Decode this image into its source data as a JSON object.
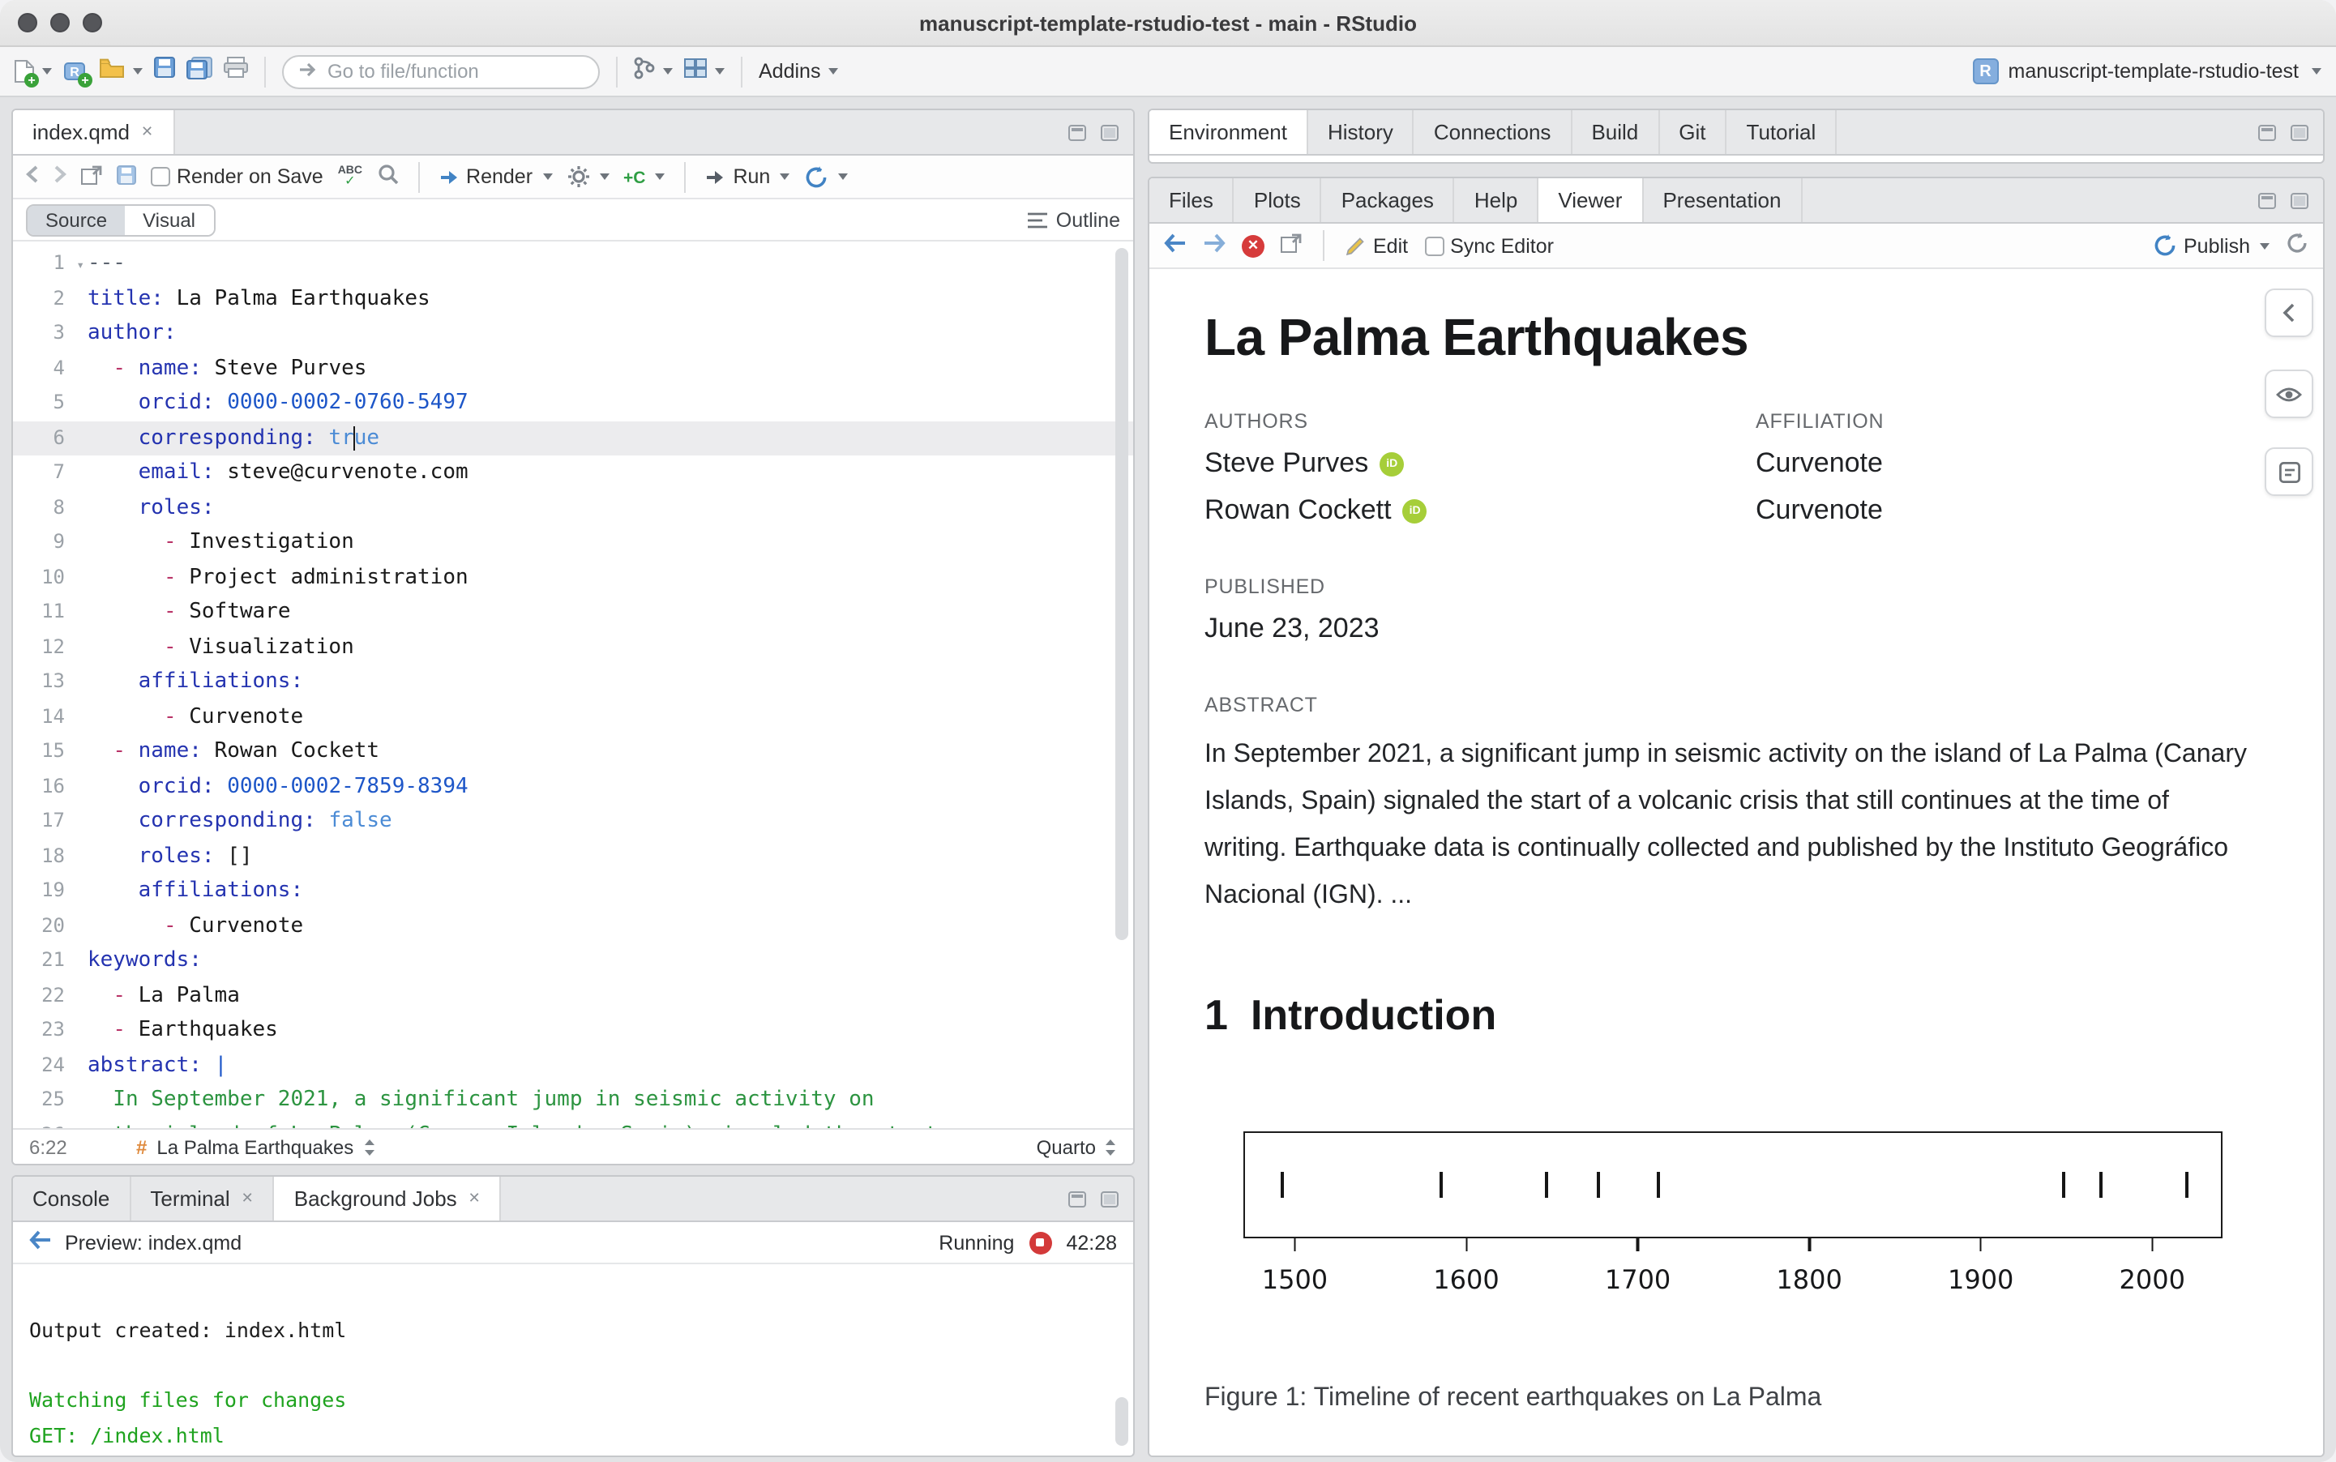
{
  "window": {
    "title": "manuscript-template-rstudio-test - main - RStudio"
  },
  "icons": {
    "close": "✕",
    "fold": "▾",
    "hash": "#"
  },
  "main_toolbar": {
    "goto_placeholder": "Go to file/function",
    "addins_label": "Addins",
    "project_label": "manuscript-template-rstudio-test"
  },
  "source_pane": {
    "tabs": [
      {
        "label": "index.qmd",
        "close": true,
        "active": true
      }
    ],
    "toolbar": {
      "render_on_save_label": "Render on Save",
      "render_label": "Render",
      "run_label": "Run"
    },
    "mode_toggle": {
      "source_label": "Source",
      "visual_label": "Visual"
    },
    "outline_label": "Outline",
    "status": {
      "cursor_position": "6:22",
      "section_label": "La Palma Earthquakes",
      "doc_type": "Quarto"
    },
    "code_lines": [
      {
        "n": 1,
        "fold": true,
        "tokens": [
          [
            "meta",
            "---"
          ]
        ]
      },
      {
        "n": 2,
        "tokens": [
          [
            "key",
            "title:"
          ],
          [
            "plain",
            " La Palma Earthquakes"
          ]
        ]
      },
      {
        "n": 3,
        "tokens": [
          [
            "key",
            "author:"
          ]
        ]
      },
      {
        "n": 4,
        "tokens": [
          [
            "plain",
            "  "
          ],
          [
            "dash",
            "- "
          ],
          [
            "key",
            "name:"
          ],
          [
            "plain",
            " Steve Purves"
          ]
        ]
      },
      {
        "n": 5,
        "tokens": [
          [
            "plain",
            "    "
          ],
          [
            "key",
            "orcid:"
          ],
          [
            "plain",
            " "
          ],
          [
            "num",
            "0000-0002-0760-5497"
          ]
        ]
      },
      {
        "n": 6,
        "highlight": true,
        "tokens": [
          [
            "plain",
            "    "
          ],
          [
            "key",
            "corresponding:"
          ],
          [
            "plain",
            " "
          ],
          [
            "bool",
            "tr"
          ],
          [
            "cursor",
            ""
          ],
          [
            "bool",
            "ue"
          ]
        ]
      },
      {
        "n": 7,
        "tokens": [
          [
            "plain",
            "    "
          ],
          [
            "key",
            "email:"
          ],
          [
            "plain",
            " steve@curvenote.com"
          ]
        ]
      },
      {
        "n": 8,
        "tokens": [
          [
            "plain",
            "    "
          ],
          [
            "key",
            "roles:"
          ]
        ]
      },
      {
        "n": 9,
        "tokens": [
          [
            "plain",
            "      "
          ],
          [
            "dash",
            "- "
          ],
          [
            "plain",
            "Investigation"
          ]
        ]
      },
      {
        "n": 10,
        "tokens": [
          [
            "plain",
            "      "
          ],
          [
            "dash",
            "- "
          ],
          [
            "plain",
            "Project administration"
          ]
        ]
      },
      {
        "n": 11,
        "tokens": [
          [
            "plain",
            "      "
          ],
          [
            "dash",
            "- "
          ],
          [
            "plain",
            "Software"
          ]
        ]
      },
      {
        "n": 12,
        "tokens": [
          [
            "plain",
            "      "
          ],
          [
            "dash",
            "- "
          ],
          [
            "plain",
            "Visualization"
          ]
        ]
      },
      {
        "n": 13,
        "tokens": [
          [
            "plain",
            "    "
          ],
          [
            "key",
            "affiliations:"
          ]
        ]
      },
      {
        "n": 14,
        "tokens": [
          [
            "plain",
            "      "
          ],
          [
            "dash",
            "- "
          ],
          [
            "plain",
            "Curvenote"
          ]
        ]
      },
      {
        "n": 15,
        "tokens": [
          [
            "plain",
            "  "
          ],
          [
            "dash",
            "- "
          ],
          [
            "key",
            "name:"
          ],
          [
            "plain",
            " Rowan Cockett"
          ]
        ]
      },
      {
        "n": 16,
        "tokens": [
          [
            "plain",
            "    "
          ],
          [
            "key",
            "orcid:"
          ],
          [
            "plain",
            " "
          ],
          [
            "num",
            "0000-0002-7859-8394"
          ]
        ]
      },
      {
        "n": 17,
        "tokens": [
          [
            "plain",
            "    "
          ],
          [
            "key",
            "corresponding:"
          ],
          [
            "plain",
            " "
          ],
          [
            "bool",
            "false"
          ]
        ]
      },
      {
        "n": 18,
        "tokens": [
          [
            "plain",
            "    "
          ],
          [
            "key",
            "roles:"
          ],
          [
            "plain",
            " []"
          ]
        ]
      },
      {
        "n": 19,
        "tokens": [
          [
            "plain",
            "    "
          ],
          [
            "key",
            "affiliations:"
          ]
        ]
      },
      {
        "n": 20,
        "tokens": [
          [
            "plain",
            "      "
          ],
          [
            "dash",
            "- "
          ],
          [
            "plain",
            "Curvenote"
          ]
        ]
      },
      {
        "n": 21,
        "tokens": [
          [
            "key",
            "keywords:"
          ]
        ]
      },
      {
        "n": 22,
        "tokens": [
          [
            "plain",
            "  "
          ],
          [
            "dash",
            "- "
          ],
          [
            "plain",
            "La Palma"
          ]
        ]
      },
      {
        "n": 23,
        "tokens": [
          [
            "plain",
            "  "
          ],
          [
            "dash",
            "- "
          ],
          [
            "plain",
            "Earthquakes"
          ]
        ]
      },
      {
        "n": 24,
        "tokens": [
          [
            "key",
            "abstract:"
          ],
          [
            "plain",
            " "
          ],
          [
            "num",
            "|"
          ]
        ]
      },
      {
        "n": 25,
        "tokens": [
          [
            "str",
            "  In September 2021, a significant jump in seismic activity on"
          ]
        ]
      },
      {
        "n": 26,
        "tokens": [
          [
            "str",
            "  the island of La Palma (Canary Islands, Spain) signaled the start"
          ]
        ]
      }
    ]
  },
  "console_pane": {
    "tabs": [
      {
        "label": "Console"
      },
      {
        "label": "Terminal",
        "close": true
      },
      {
        "label": "Background Jobs",
        "close": true,
        "active": true
      }
    ],
    "header": {
      "title": "Preview: index.qmd",
      "status": "Running",
      "elapsed": "42:28"
    },
    "output_lines": [
      {
        "text": "Output created: index.html",
        "kind": "plain"
      },
      {
        "text": "",
        "kind": "plain"
      },
      {
        "text": "Watching files for changes",
        "kind": "success"
      },
      {
        "text": "GET: /index.html",
        "kind": "success"
      }
    ]
  },
  "right_top": {
    "tabs": [
      "Environment",
      "History",
      "Connections",
      "Build",
      "Git",
      "Tutorial"
    ],
    "active_tab": "Environment"
  },
  "viewer_pane": {
    "tabs": [
      "Files",
      "Plots",
      "Packages",
      "Help",
      "Viewer",
      "Presentation"
    ],
    "active_tab": "Viewer",
    "toolbar": {
      "edit_label": "Edit",
      "sync_editor_label": "Sync Editor",
      "publish_label": "Publish"
    }
  },
  "article": {
    "title": "La Palma Earthquakes",
    "authors_label": "AUTHORS",
    "affiliation_label": "AFFILIATION",
    "authors": [
      {
        "name": "Steve Purves",
        "affiliation": "Curvenote"
      },
      {
        "name": "Rowan Cockett",
        "affiliation": "Curvenote"
      }
    ],
    "published_label": "PUBLISHED",
    "published_date": "June 23, 2023",
    "abstract_label": "ABSTRACT",
    "abstract_text": "In September 2021, a significant jump in seismic activity on the island of La Palma (Canary Islands, Spain) signaled the start of a volcanic crisis that still continues at the time of writing. Earthquake data is continually collected and published by the Instituto Geográfico Nacional (IGN). ...",
    "section_heading": {
      "number": "1",
      "text": "Introduction"
    }
  },
  "chart_data": {
    "type": "scatter",
    "title": "Timeline of recent earthquakes on La Palma",
    "marker": "vertical-tick",
    "x_values": [
      1492,
      1585,
      1646,
      1677,
      1712,
      1949,
      1971,
      2021
    ],
    "x_ticks": [
      1500,
      1600,
      1700,
      1800,
      1900,
      2000
    ],
    "xlim": [
      1470,
      2041
    ],
    "xlabel": "",
    "ylabel": "",
    "caption": "Figure 1: Timeline of recent earthquakes on La Palma"
  }
}
